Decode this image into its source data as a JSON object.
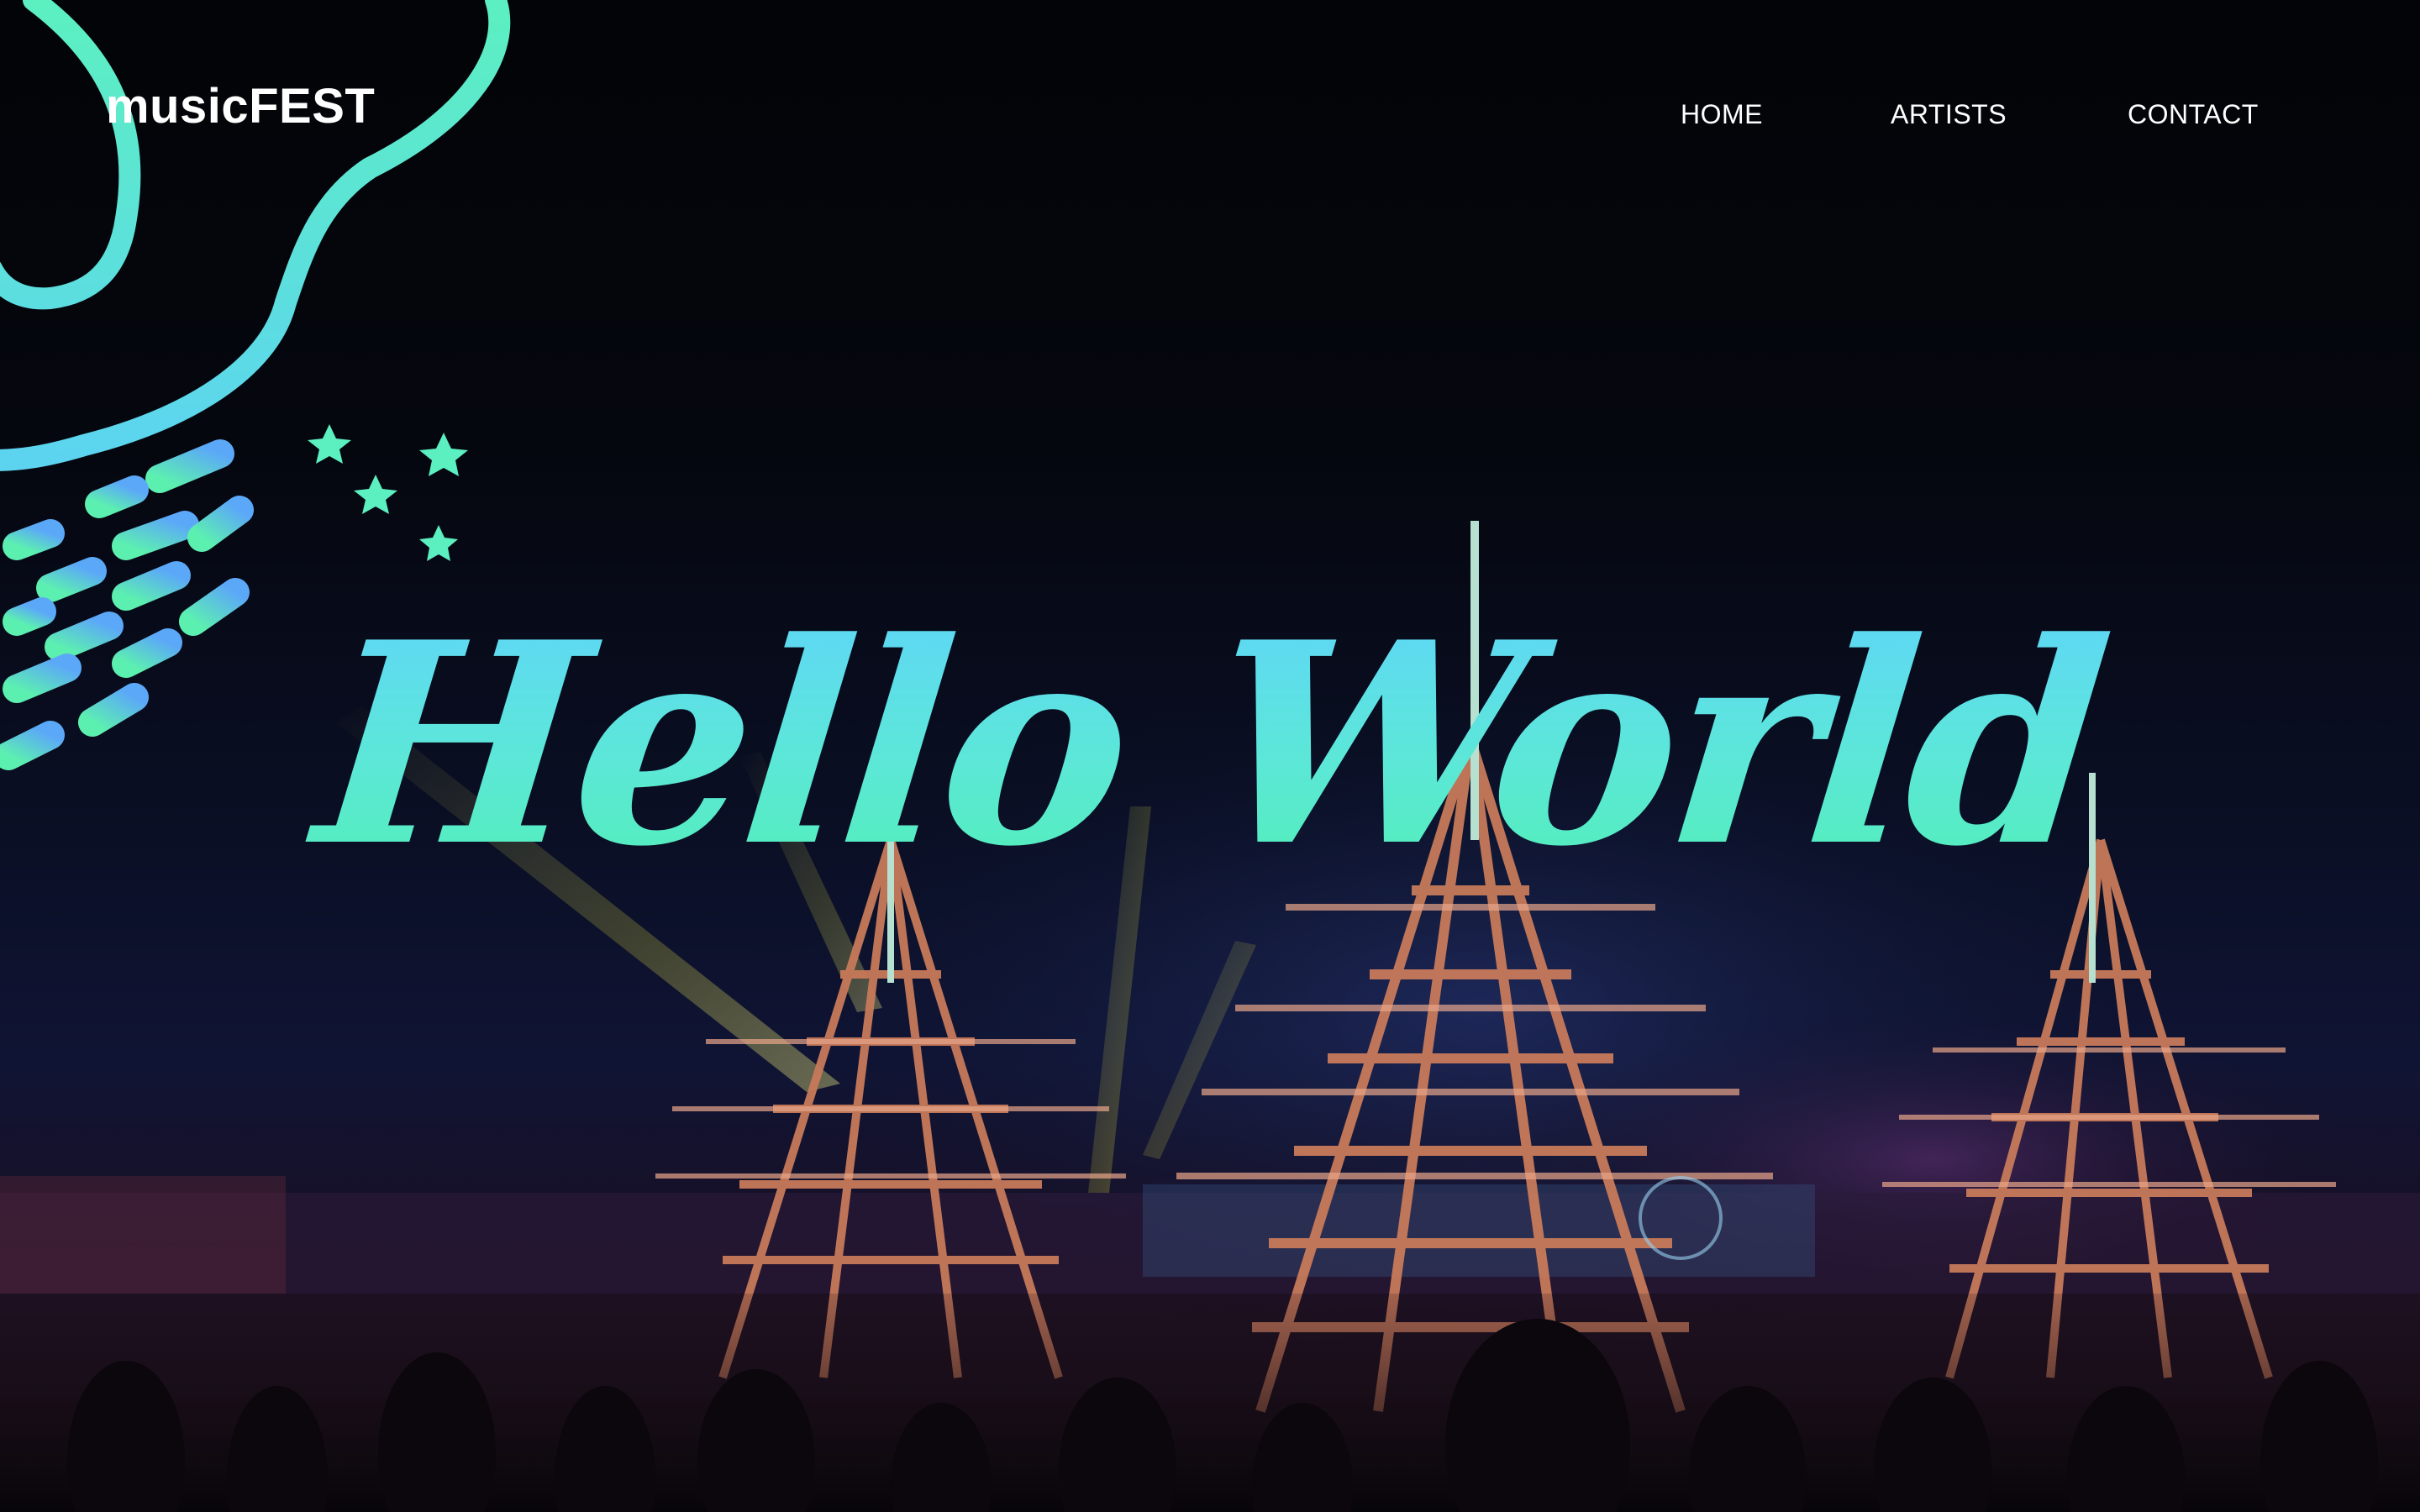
{
  "brand": {
    "logo": "musicFEST"
  },
  "nav": {
    "items": [
      {
        "label": "HOME"
      },
      {
        "label": "ARTISTS"
      },
      {
        "label": "CONTACT"
      }
    ]
  },
  "hero": {
    "title": "Hello World"
  },
  "colors": {
    "accent_top": "#5fd6f8",
    "accent_bottom": "#52efb8",
    "background": "#04050a",
    "text": "#ffffff"
  },
  "icons": {
    "decoration": "hand-drawn-doodle-icon",
    "stars": "star-icon"
  }
}
